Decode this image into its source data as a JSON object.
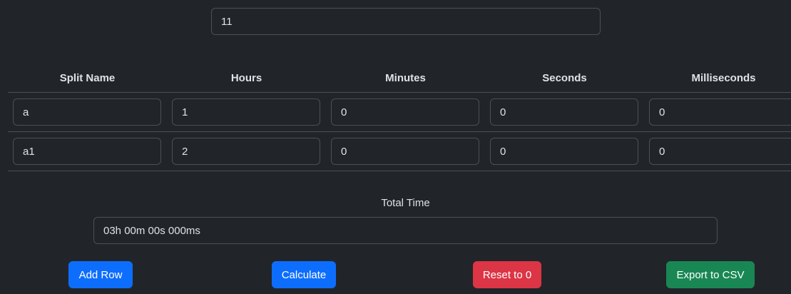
{
  "top_field": {
    "value": "11"
  },
  "table": {
    "headers": [
      "Split Name",
      "Hours",
      "Minutes",
      "Seconds",
      "Milliseconds"
    ],
    "rows": [
      [
        "a",
        "1",
        "0",
        "0",
        "0"
      ],
      [
        "a1",
        "2",
        "0",
        "0",
        "0"
      ]
    ]
  },
  "total": {
    "label": "Total Time",
    "value": "03h 00m 00s 000ms"
  },
  "buttons": {
    "add_row": "Add Row",
    "calculate": "Calculate",
    "reset": "Reset to 0",
    "export": "Export to CSV"
  },
  "colors": {
    "background": "#212529",
    "primary": "#0d6efd",
    "danger": "#dc3545",
    "success": "#198754"
  }
}
